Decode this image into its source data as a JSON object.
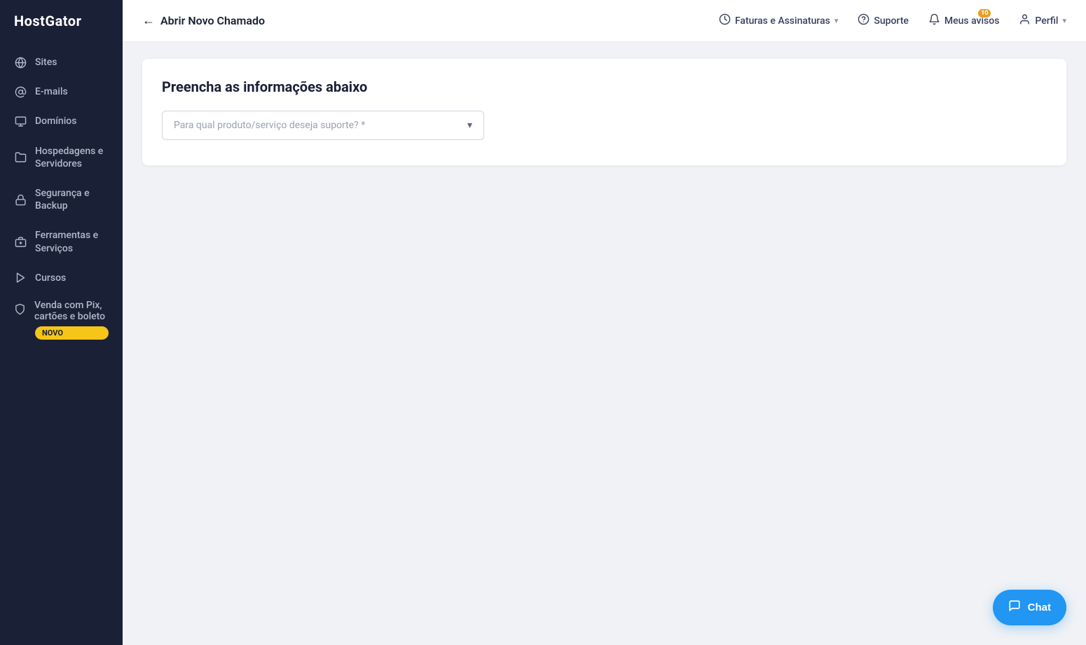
{
  "sidebar": {
    "logo": {
      "text": "HostGator"
    },
    "items": [
      {
        "id": "sites",
        "label": "Sites",
        "icon": "🌐"
      },
      {
        "id": "emails",
        "label": "E-mails",
        "icon": "✉"
      },
      {
        "id": "dominios",
        "label": "Domínios",
        "icon": "🖥"
      },
      {
        "id": "hospedagens",
        "label": "Hospedagens e Servidores",
        "icon": "📁"
      },
      {
        "id": "seguranca",
        "label": "Segurança e Backup",
        "icon": "🔒"
      },
      {
        "id": "ferramentas",
        "label": "Ferramentas e Serviços",
        "icon": "🔧"
      },
      {
        "id": "cursos",
        "label": "Cursos",
        "icon": "▶"
      },
      {
        "id": "venda",
        "label": "Venda com Pix, cartões e boleto",
        "icon": "🛡",
        "badge": "NOVO"
      }
    ]
  },
  "header": {
    "back_label": "Abrir Novo Chamado",
    "nav": [
      {
        "id": "faturas",
        "label": "Faturas e Assinaturas",
        "has_chevron": true
      },
      {
        "id": "suporte",
        "label": "Suporte",
        "has_chevron": false
      },
      {
        "id": "avisos",
        "label": "Meus avisos",
        "has_chevron": false,
        "badge": "10"
      },
      {
        "id": "perfil",
        "label": "Perfil",
        "has_chevron": true
      }
    ]
  },
  "form": {
    "title": "Preencha as informações abaixo",
    "dropdown_placeholder": "Para qual produto/serviço deseja suporte? *"
  },
  "chat": {
    "label": "Chat"
  }
}
